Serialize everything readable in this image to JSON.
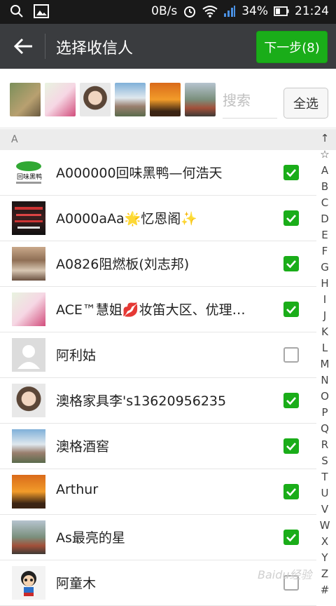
{
  "status": {
    "speed": "0B/s",
    "battery": "34%",
    "time": "21:24"
  },
  "header": {
    "title": "选择收信人",
    "next_label": "下一步(8)"
  },
  "selection": {
    "search_placeholder": "搜索",
    "select_all_label": "全选"
  },
  "section": {
    "letter": "A"
  },
  "contacts": [
    {
      "name": "A000000回味黑鸭—何浩天",
      "checked": true
    },
    {
      "name": "A0000aAa🌟忆恩阁✨",
      "checked": true
    },
    {
      "name": "A0826阻燃板(刘志邦)",
      "checked": true
    },
    {
      "name": "ACE™慧姐💋妆笛大区、优理…",
      "checked": true
    },
    {
      "name": "阿利姑",
      "checked": false
    },
    {
      "name": "澳格家具李's13620956235",
      "checked": true
    },
    {
      "name": "澳格酒窖",
      "checked": true
    },
    {
      "name": "Arthur",
      "checked": true
    },
    {
      "name": "As最亮的星",
      "checked": true
    },
    {
      "name": "阿童木",
      "checked": false
    }
  ],
  "index_letters": [
    "↑",
    "☆",
    "A",
    "B",
    "C",
    "D",
    "E",
    "F",
    "G",
    "H",
    "I",
    "J",
    "K",
    "L",
    "M",
    "N",
    "O",
    "P",
    "Q",
    "R",
    "S",
    "T",
    "U",
    "V",
    "W",
    "X",
    "Y",
    "Z",
    "#"
  ],
  "watermark": "Baidu经验",
  "colors": {
    "accent": "#1aad19",
    "appbar": "#3a3c3f",
    "statusbar": "#191919"
  }
}
